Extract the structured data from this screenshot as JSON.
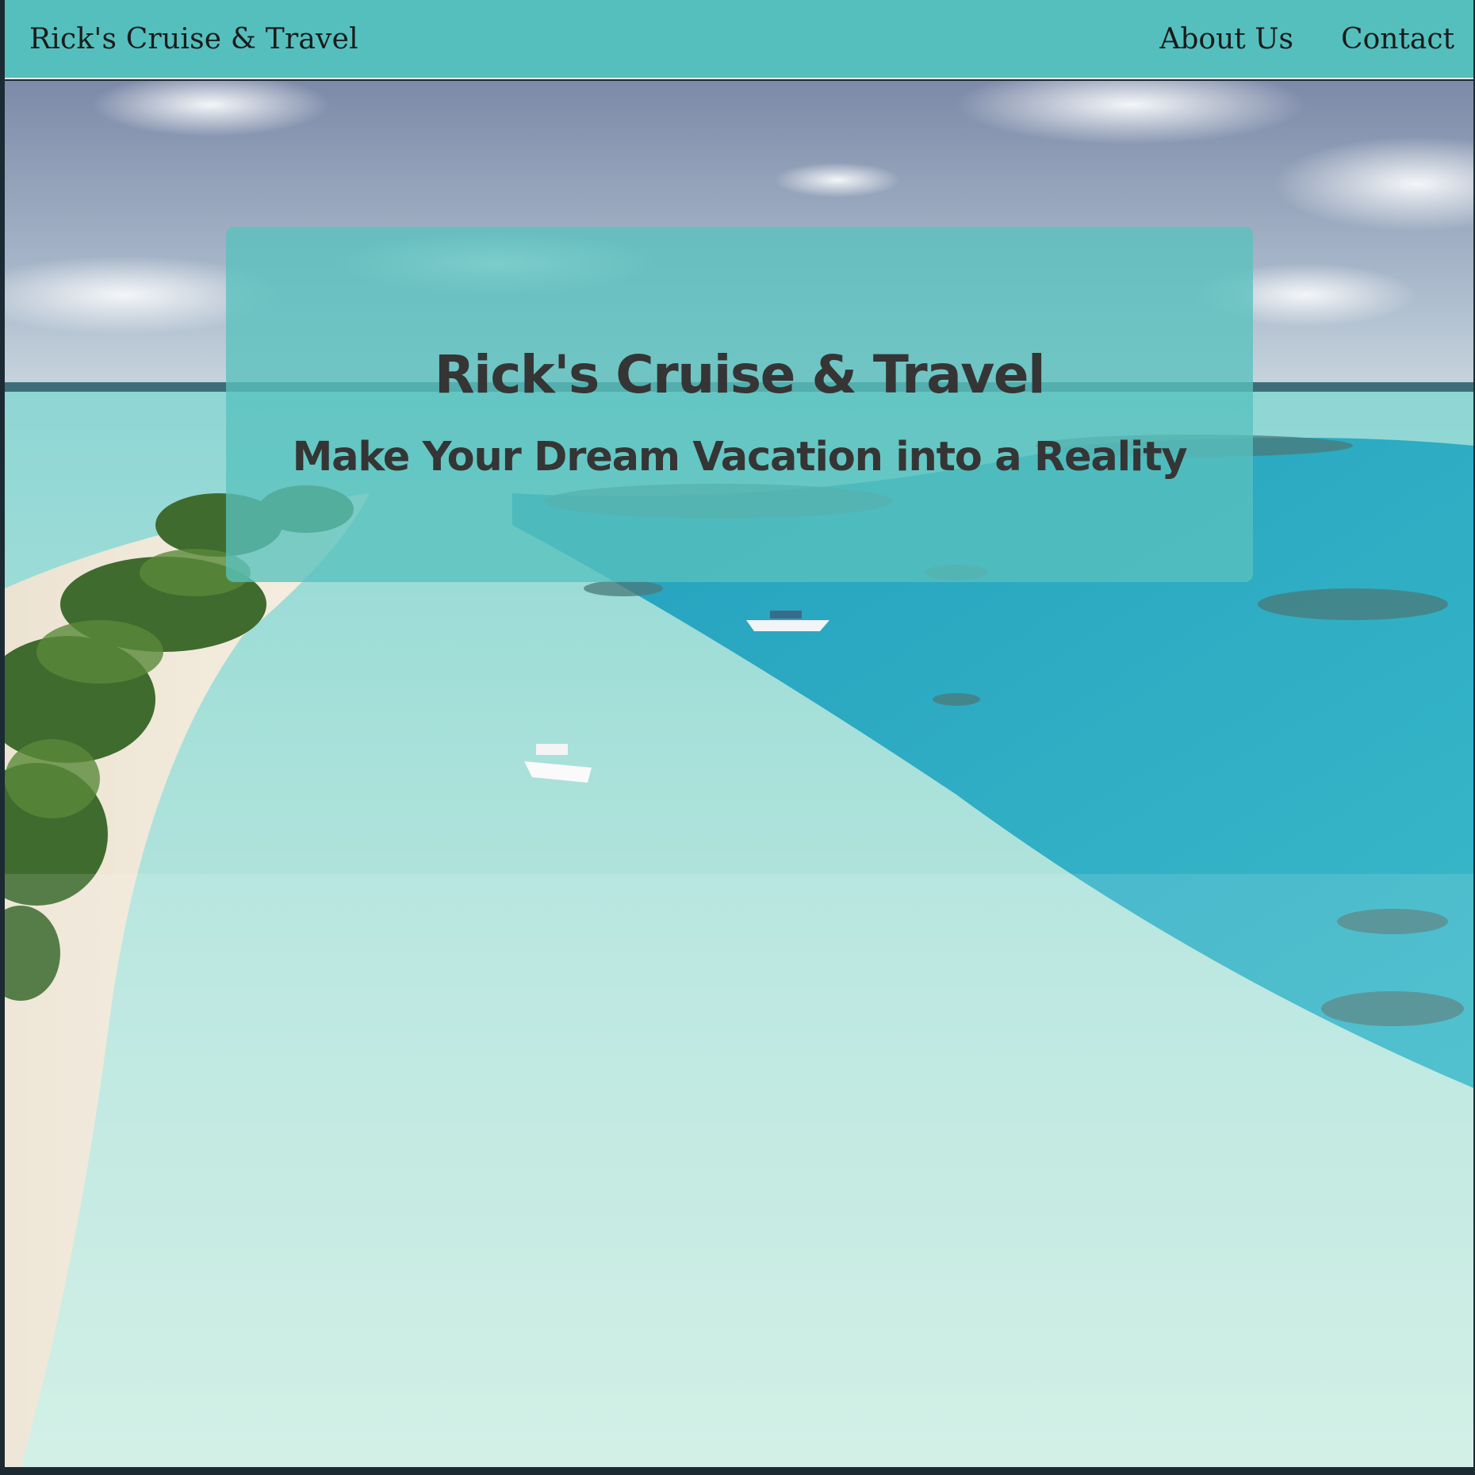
{
  "navbar": {
    "brand": "Rick's Cruise & Travel",
    "links": [
      {
        "label": "About Us"
      },
      {
        "label": "Contact"
      }
    ]
  },
  "hero": {
    "title": "Rick's Cruise & Travel",
    "subtitle": "Make Your Dream Vacation into a Reality",
    "background_image": "tropical-beach-aerial-photo"
  },
  "colors": {
    "navbar": "#55bfbd",
    "panel": "#58c2be",
    "text_dark": "#353535"
  }
}
